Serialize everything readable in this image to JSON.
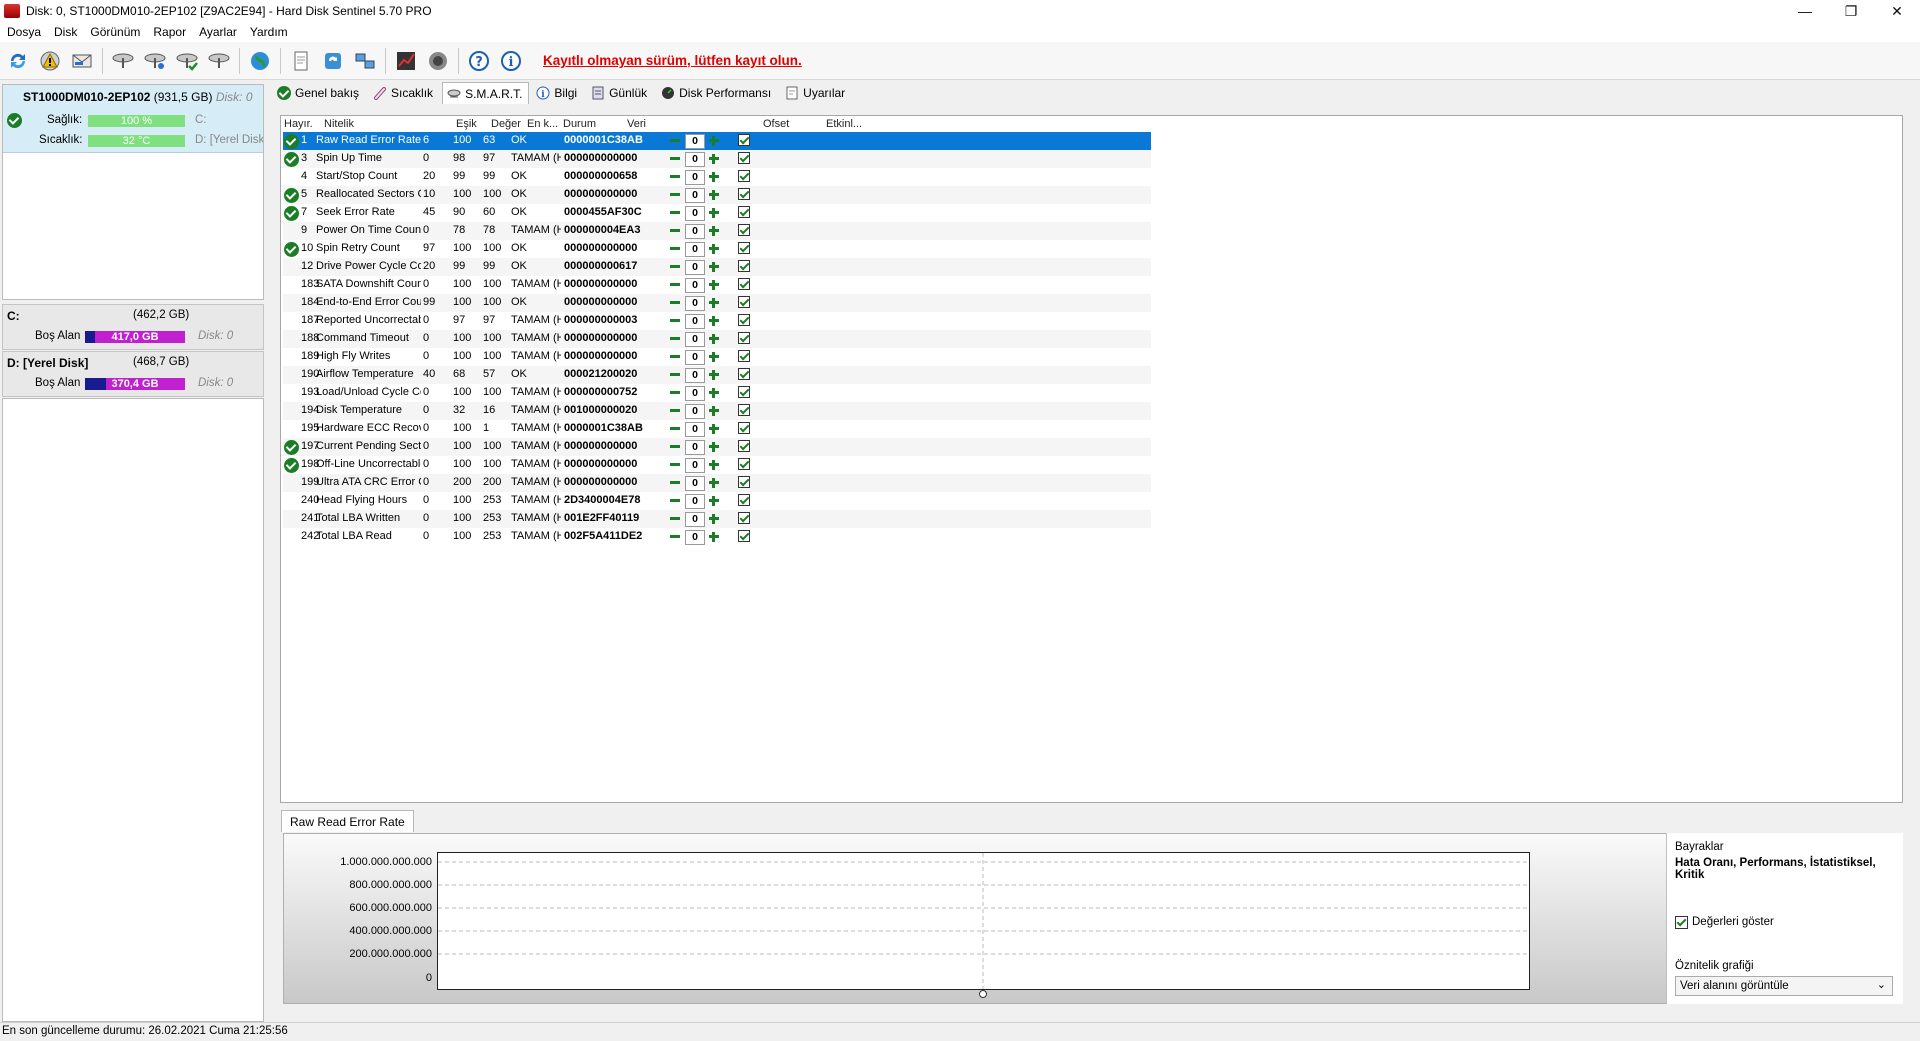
{
  "window": {
    "title": "Disk: 0, ST1000DM010-2EP102 [Z9AC2E94]  -  Hard Disk Sentinel 5.70 PRO",
    "controls": [
      "—",
      "❐",
      "✕"
    ]
  },
  "menu": [
    "Dosya",
    "Disk",
    "Görünüm",
    "Rapor",
    "Ayarlar",
    "Yardım"
  ],
  "toolbar": {
    "icons": [
      "refresh-icon",
      "alert-icon",
      "mail-icon",
      "disk-tool-icon",
      "disk-scan-icon",
      "disk-check-icon",
      "disk-settings-icon",
      "globe-icon",
      "report-icon",
      "send-report-icon",
      "network-icon",
      "performance-icon",
      "sound-icon",
      "help-icon",
      "info-icon"
    ],
    "warning": "Kayıtlı olmayan sürüm, lütfen kayıt olun."
  },
  "disk": {
    "name": "ST1000DM010-2EP102",
    "size": "(931,5 GB)",
    "num": "Disk: 0",
    "health_label": "Sağlık:",
    "health_value": "100 %",
    "health_fraction": 1.0,
    "temp_label": "Sıcaklık:",
    "temp_value": "32 °C",
    "part1": "C:",
    "part2": "D: [Yerel Disk]"
  },
  "partitions": [
    {
      "name": "C:",
      "size": "(462,2 GB)",
      "free_label": "Boş Alan",
      "free": "417,0 GB",
      "free_fraction": 0.9,
      "disk": "Disk: 0"
    },
    {
      "name": "D: [Yerel Disk]",
      "size": "(468,7 GB)",
      "free_label": "Boş Alan",
      "free": "370,4 GB",
      "free_fraction": 0.79,
      "disk": "Disk: 0"
    }
  ],
  "tabs": [
    "Genel bakış",
    "Sıcaklık",
    "S.M.A.R.T.",
    "Bilgi",
    "Günlük",
    "Disk Performansı",
    "Uyarılar"
  ],
  "smart": {
    "headers": [
      "Hayır.",
      "Nitelik",
      "Eşik",
      "Değer",
      "En k...",
      "Durum",
      "Veri",
      "Ofset",
      "Etkinl..."
    ],
    "rows": [
      {
        "id": "1",
        "name": "Raw Read Error Rate",
        "th": "6",
        "val": "100",
        "worst": "63",
        "status": "OK",
        "data": "0000001C38AB",
        "ok": true,
        "sel": true
      },
      {
        "id": "3",
        "name": "Spin Up Time",
        "th": "0",
        "val": "98",
        "worst": "97",
        "status": "TAMAM (H...",
        "data": "000000000000",
        "ok": true
      },
      {
        "id": "4",
        "name": "Start/Stop Count",
        "th": "20",
        "val": "99",
        "worst": "99",
        "status": "OK",
        "data": "000000000658",
        "ok": false
      },
      {
        "id": "5",
        "name": "Reallocated Sectors Co...",
        "th": "10",
        "val": "100",
        "worst": "100",
        "status": "OK",
        "data": "000000000000",
        "ok": true
      },
      {
        "id": "7",
        "name": "Seek Error Rate",
        "th": "45",
        "val": "90",
        "worst": "60",
        "status": "OK",
        "data": "0000455AF30C",
        "ok": true
      },
      {
        "id": "9",
        "name": "Power On Time Count",
        "th": "0",
        "val": "78",
        "worst": "78",
        "status": "TAMAM (H...",
        "data": "000000004EA3",
        "ok": false
      },
      {
        "id": "10",
        "name": "Spin Retry Count",
        "th": "97",
        "val": "100",
        "worst": "100",
        "status": "OK",
        "data": "000000000000",
        "ok": true
      },
      {
        "id": "12",
        "name": "Drive Power Cycle Count",
        "th": "20",
        "val": "99",
        "worst": "99",
        "status": "OK",
        "data": "000000000617",
        "ok": false
      },
      {
        "id": "183",
        "name": "SATA Downshift Count",
        "th": "0",
        "val": "100",
        "worst": "100",
        "status": "TAMAM (H...",
        "data": "000000000000",
        "ok": false
      },
      {
        "id": "184",
        "name": "End-to-End Error Count",
        "th": "99",
        "val": "100",
        "worst": "100",
        "status": "OK",
        "data": "000000000000",
        "ok": false
      },
      {
        "id": "187",
        "name": "Reported Uncorrectabl...",
        "th": "0",
        "val": "97",
        "worst": "97",
        "status": "TAMAM (H...",
        "data": "000000000003",
        "ok": false
      },
      {
        "id": "188",
        "name": "Command Timeout",
        "th": "0",
        "val": "100",
        "worst": "100",
        "status": "TAMAM (H...",
        "data": "000000000000",
        "ok": false
      },
      {
        "id": "189",
        "name": "High Fly Writes",
        "th": "0",
        "val": "100",
        "worst": "100",
        "status": "TAMAM (H...",
        "data": "000000000000",
        "ok": false
      },
      {
        "id": "190",
        "name": "Airflow Temperature",
        "th": "40",
        "val": "68",
        "worst": "57",
        "status": "OK",
        "data": "000021200020",
        "ok": false
      },
      {
        "id": "193",
        "name": "Load/Unload Cycle Cou...",
        "th": "0",
        "val": "100",
        "worst": "100",
        "status": "TAMAM (H...",
        "data": "000000000752",
        "ok": false
      },
      {
        "id": "194",
        "name": "Disk Temperature",
        "th": "0",
        "val": "32",
        "worst": "16",
        "status": "TAMAM (H...",
        "data": "001000000020",
        "ok": false
      },
      {
        "id": "195",
        "name": "Hardware ECC Recovered",
        "th": "0",
        "val": "100",
        "worst": "1",
        "status": "TAMAM (H...",
        "data": "0000001C38AB",
        "ok": false
      },
      {
        "id": "197",
        "name": "Current Pending Sector...",
        "th": "0",
        "val": "100",
        "worst": "100",
        "status": "TAMAM (H...",
        "data": "000000000000",
        "ok": true
      },
      {
        "id": "198",
        "name": "Off-Line Uncorrectable ...",
        "th": "0",
        "val": "100",
        "worst": "100",
        "status": "TAMAM (H...",
        "data": "000000000000",
        "ok": true
      },
      {
        "id": "199",
        "name": "Ultra ATA CRC Error Co...",
        "th": "0",
        "val": "200",
        "worst": "200",
        "status": "TAMAM (H...",
        "data": "000000000000",
        "ok": false
      },
      {
        "id": "240",
        "name": "Head Flying Hours",
        "th": "0",
        "val": "100",
        "worst": "253",
        "status": "TAMAM (H...",
        "data": "2D3400004E78",
        "ok": false
      },
      {
        "id": "241",
        "name": "Total LBA Written",
        "th": "0",
        "val": "100",
        "worst": "253",
        "status": "TAMAM (H...",
        "data": "001E2FF40119",
        "ok": false
      },
      {
        "id": "242",
        "name": "Total LBA Read",
        "th": "0",
        "val": "100",
        "worst": "253",
        "status": "TAMAM (H...",
        "data": "002F5A411DE2",
        "ok": false
      }
    ],
    "offset_value": "0"
  },
  "bottom": {
    "tab": "Raw Read Error Rate",
    "yticks": [
      "1.000.000.000.000",
      "800.000.000.000",
      "600.000.000.000",
      "400.000.000.000",
      "200.000.000.000",
      "0"
    ],
    "flags_title": "Bayraklar",
    "flags_value": "Hata Oranı, Performans, İstatistiksel, Kritik",
    "show_values": "Değerleri göster",
    "attr_chart_label": "Öznitelik grafiği",
    "attr_chart_value": "Veri alanını görüntüle"
  },
  "status": "En son güncelleme durumu: 26.02.2021 Cuma 21:25:56"
}
